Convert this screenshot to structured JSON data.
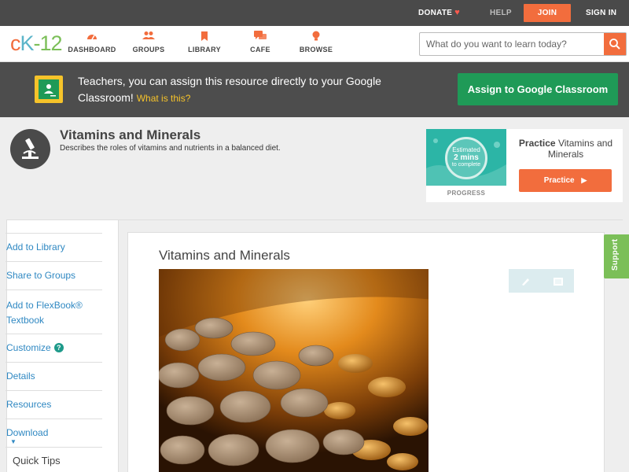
{
  "topbar": {
    "donate": "DONATE",
    "help": "HELP",
    "join": "JOIN",
    "sign_in": "SIGN IN"
  },
  "brand": {
    "logo_c": "c",
    "logo_k": "K",
    "logo_dash": "-",
    "logo_num": "12"
  },
  "nav": {
    "items": [
      {
        "label": "DASHBOARD",
        "icon": "dashboard-icon"
      },
      {
        "label": "GROUPS",
        "icon": "groups-icon"
      },
      {
        "label": "LIBRARY",
        "icon": "library-icon"
      },
      {
        "label": "CAFE",
        "icon": "cafe-icon"
      },
      {
        "label": "BROWSE",
        "icon": "browse-icon"
      }
    ],
    "search_placeholder": "What do you want to learn today?"
  },
  "banner": {
    "message": "Teachers, you can assign this resource directly to your Google Classroom!",
    "what_is_this": "What is this?",
    "assign_label": "Assign to Google Classroom"
  },
  "concept": {
    "title": "Vitamins and Minerals",
    "description": "Describes the roles of vitamins and nutrients in a balanced diet."
  },
  "practice": {
    "progress_estimated": "Estimated",
    "progress_time": "2 mins",
    "progress_complete": "to complete",
    "progress_label": "PROGRESS",
    "title_bold": "Practice",
    "title_rest": "Vitamins and Minerals",
    "button_label": "Practice"
  },
  "sidebar": {
    "items": [
      {
        "label": "Add to Library"
      },
      {
        "label": "Share to Groups"
      },
      {
        "label": "Add to FlexBook®"
      },
      {
        "label": "Textbook"
      },
      {
        "label": "Customize"
      },
      {
        "label": "Details"
      },
      {
        "label": "Resources"
      },
      {
        "label": "Download"
      }
    ],
    "help_mark": "?",
    "quick_tips": "Quick Tips"
  },
  "content": {
    "title": "Vitamins and Minerals"
  },
  "support": "Support",
  "colors": {
    "accent": "#f26d3d",
    "google_green": "#1f9a57",
    "link": "#2f88c2",
    "support_green": "#7bbf58"
  }
}
